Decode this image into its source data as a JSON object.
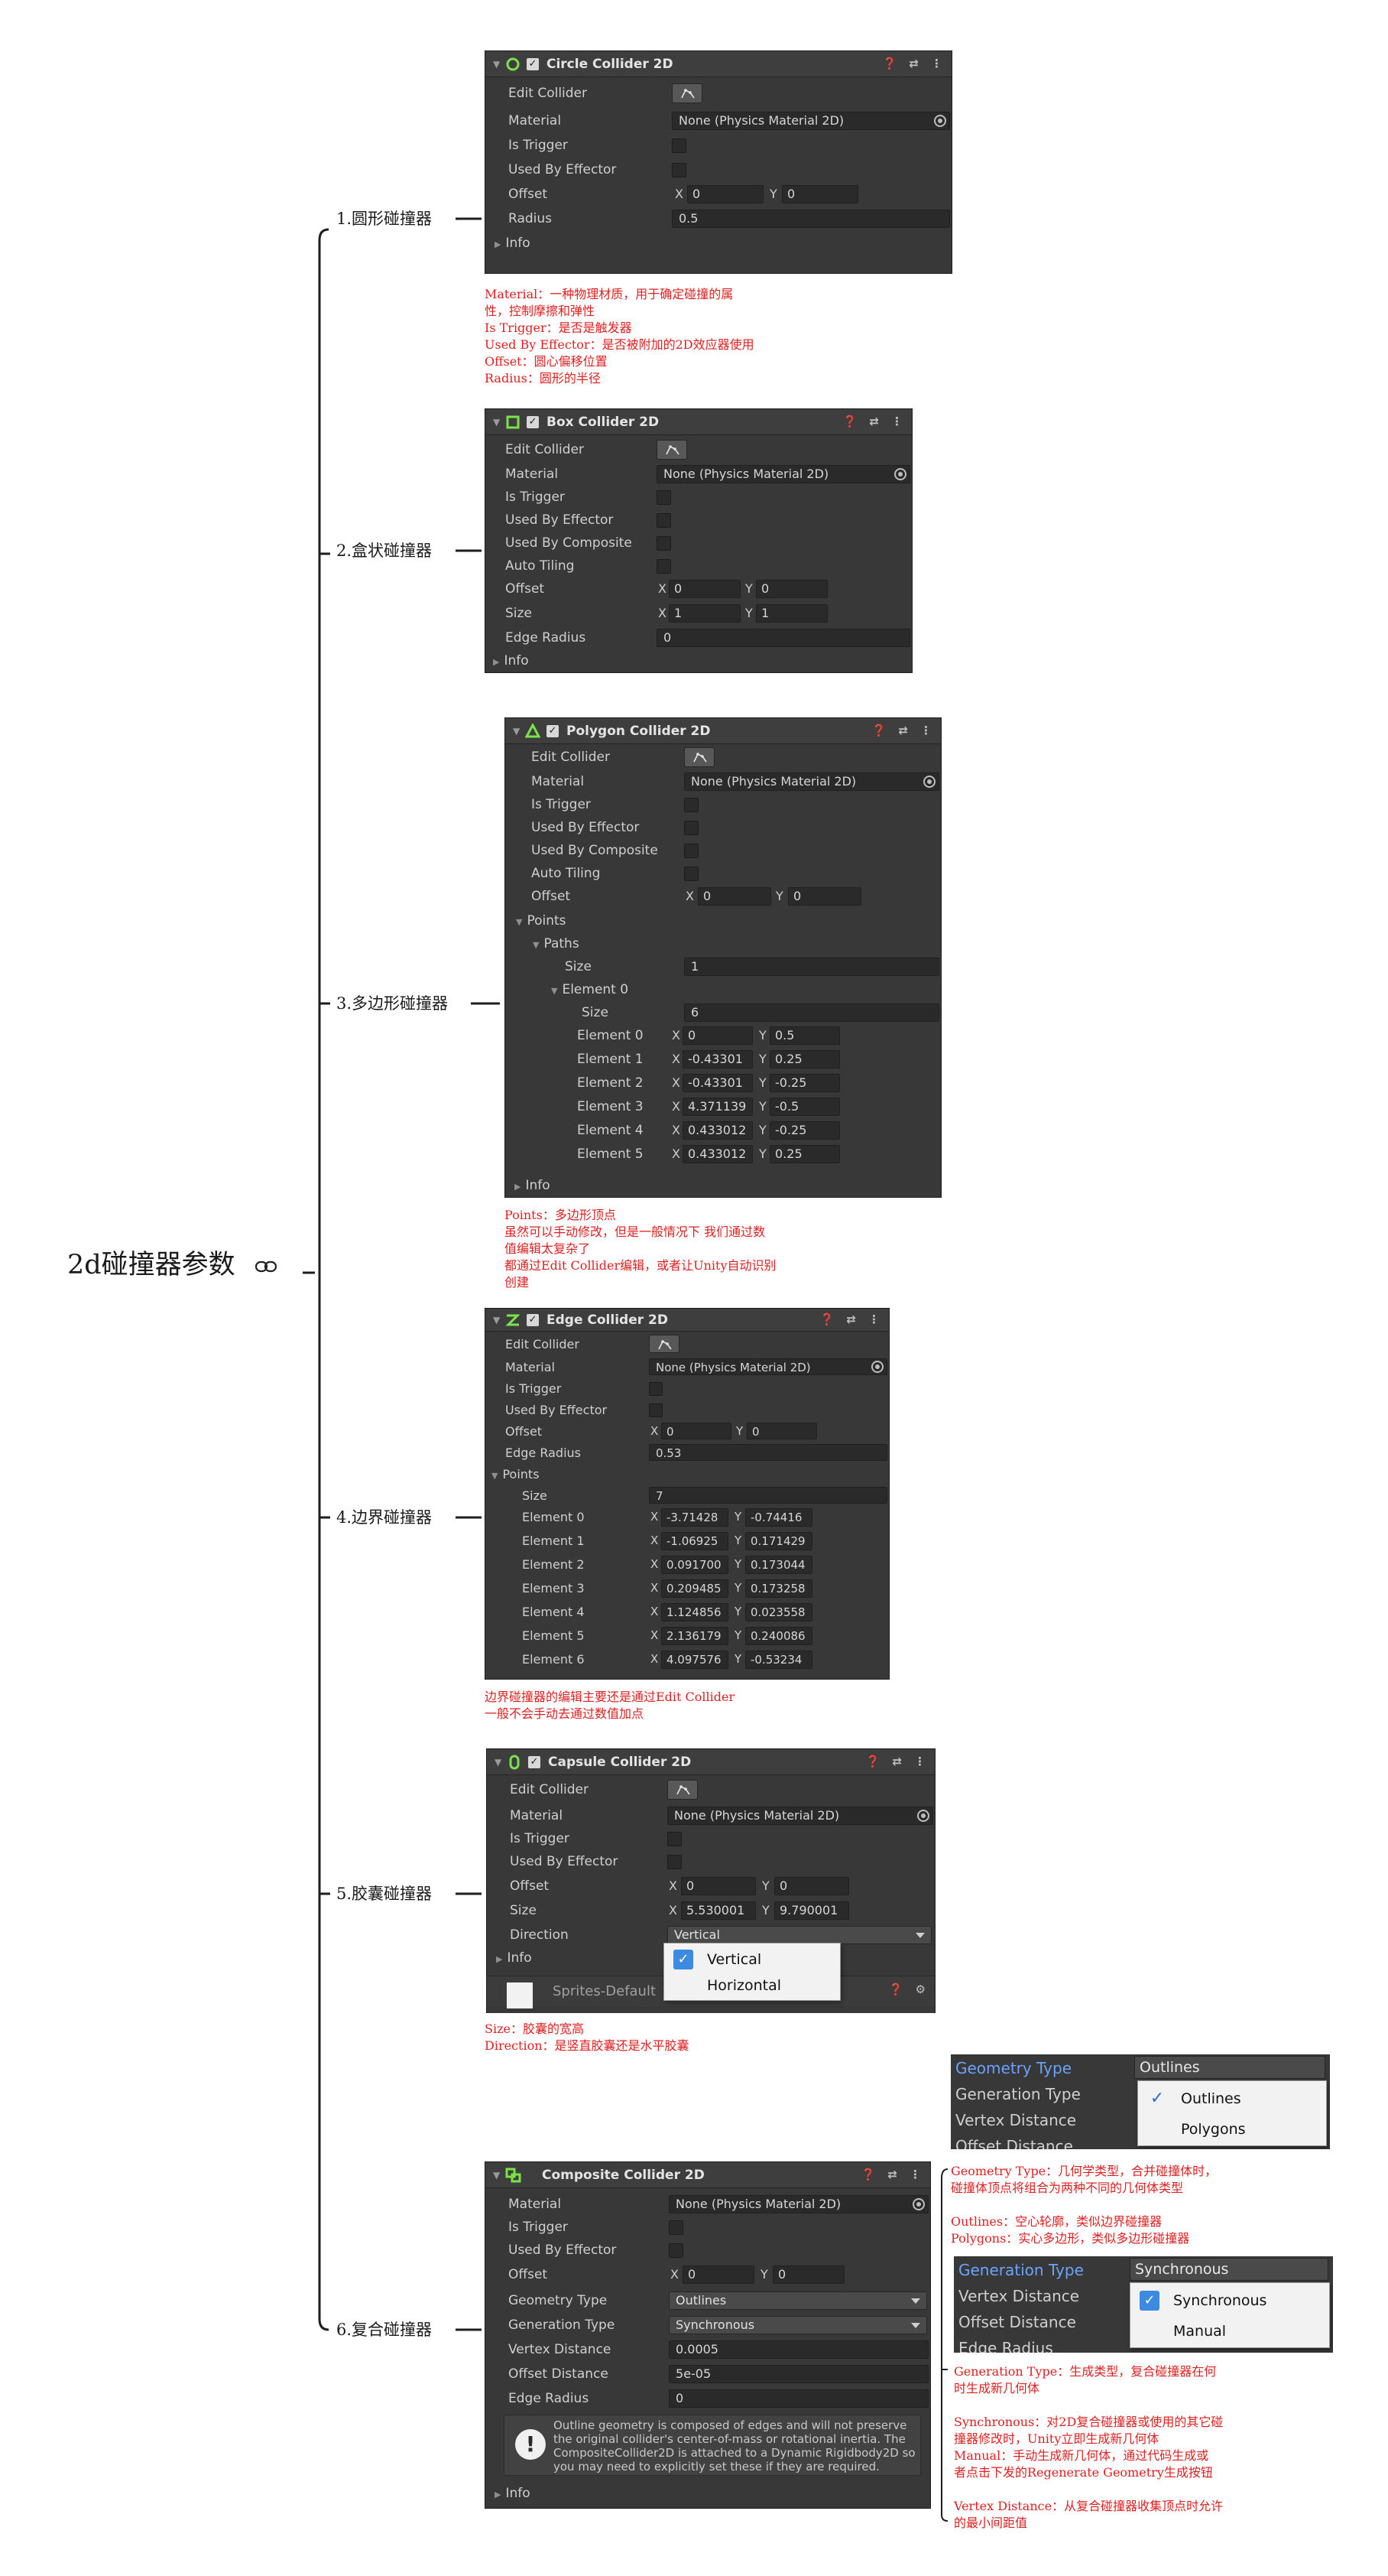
{
  "root": {
    "label": "2d碰撞器参数"
  },
  "branches": [
    "1.圆形碰撞器",
    "2.盒状碰撞器",
    "3.多边形碰撞器",
    "4.边界碰撞器",
    "5.胶囊碰撞器",
    "6.复合碰撞器"
  ],
  "common": {
    "edit_collider": "Edit Collider",
    "material": "Material",
    "material_value": "None (Physics Material 2D)",
    "is_trigger": "Is Trigger",
    "used_by_effector": "Used By Effector",
    "used_by_composite": "Used By Composite",
    "auto_tiling": "Auto Tiling",
    "offset": "Offset",
    "size": "Size",
    "radius": "Radius",
    "edge_radius": "Edge Radius",
    "points": "Points",
    "paths": "Paths",
    "info": "Info",
    "x": "X",
    "y": "Y"
  },
  "circle": {
    "title": "Circle Collider 2D",
    "offset_x": "0",
    "offset_y": "0",
    "radius": "0.5"
  },
  "circle_notes": [
    "Material：一种物理材质，用于确定碰撞的属",
    "性，控制摩擦和弹性",
    "Is Trigger：是否是触发器",
    "Used By Effector：是否被附加的2D效应器使用",
    "Offset：圆心偏移位置",
    "Radius：圆形的半径"
  ],
  "box": {
    "title": "Box Collider 2D",
    "offset_x": "0",
    "offset_y": "0",
    "size_x": "1",
    "size_y": "1",
    "edge_radius": "0"
  },
  "polygon": {
    "title": "Polygon Collider 2D",
    "offset_x": "0",
    "offset_y": "0",
    "paths_size": "1",
    "element0_label": "Element 0",
    "element_size": "6",
    "elements": [
      {
        "label": "Element 0",
        "x": "0",
        "y": "0.5"
      },
      {
        "label": "Element 1",
        "x": "-0.43301",
        "y": "0.25"
      },
      {
        "label": "Element 2",
        "x": "-0.43301",
        "y": "-0.25"
      },
      {
        "label": "Element 3",
        "x": "4.371139",
        "y": "-0.5"
      },
      {
        "label": "Element 4",
        "x": "0.433012",
        "y": "-0.25"
      },
      {
        "label": "Element 5",
        "x": "0.433012",
        "y": "0.25"
      }
    ]
  },
  "polygon_notes": [
    "Points：多边形顶点",
    "虽然可以手动修改，但是一般情况下 我们通过数",
    "值编辑太复杂了",
    "都通过Edit Collider编辑，或者让Unity自动识别",
    "创建"
  ],
  "edge": {
    "title": "Edge Collider 2D",
    "offset_x": "0",
    "offset_y": "0",
    "edge_radius": "0.53",
    "points_size": "7",
    "elements": [
      {
        "label": "Element 0",
        "x": "-3.71428",
        "y": "-0.74416"
      },
      {
        "label": "Element 1",
        "x": "-1.06925",
        "y": "0.171429"
      },
      {
        "label": "Element 2",
        "x": "0.091700",
        "y": "0.173044"
      },
      {
        "label": "Element 3",
        "x": "0.209485",
        "y": "0.173258"
      },
      {
        "label": "Element 4",
        "x": "1.124856",
        "y": "0.023558"
      },
      {
        "label": "Element 5",
        "x": "2.136179",
        "y": "0.240086"
      },
      {
        "label": "Element 6",
        "x": "4.097576",
        "y": "-0.53234"
      }
    ]
  },
  "edge_notes": [
    "边界碰撞器的编辑主要还是通过Edit Collider",
    "一般不会手动去通过数值加点"
  ],
  "capsule": {
    "title": "Capsule Collider 2D",
    "offset_x": "0",
    "offset_y": "0",
    "size_x": "5.530001",
    "size_y": "9.790001",
    "direction_label": "Direction",
    "direction_value": "Vertical",
    "options": [
      "Vertical",
      "Horizontal"
    ],
    "behind_text": "Sprites-Default"
  },
  "capsule_notes": [
    "Size：胶囊的宽高",
    "Direction：是竖直胶囊还是水平胶囊"
  ],
  "composite": {
    "title": "Composite Collider 2D",
    "offset_x": "0",
    "offset_y": "0",
    "geometry_type_label": "Geometry Type",
    "geometry_type_value": "Outlines",
    "generation_type_label": "Generation Type",
    "generation_type_value": "Synchronous",
    "vertex_distance_label": "Vertex Distance",
    "vertex_distance_value": "0.0005",
    "offset_distance_label": "Offset Distance",
    "offset_distance_value": "5e-05",
    "edge_radius_value": "0",
    "help_text": "Outline geometry is composed of edges and will not preserve the original collider's center-of-mass or rotational inertia.  The CompositeCollider2D is attached to a Dynamic Rigidbody2D so you may need to explicitly set these if they are required."
  },
  "geometry_popup": {
    "rows": [
      "Geometry Type",
      "Generation Type",
      "Vertex Distance",
      "Offset Distance"
    ],
    "value": "Outlines",
    "options": [
      "Outlines",
      "Polygons"
    ]
  },
  "generation_popup": {
    "rows": [
      "Generation Type",
      "Vertex Distance",
      "Offset Distance",
      "Edge Radius"
    ],
    "value": "Synchronous",
    "options": [
      "Synchronous",
      "Manual"
    ]
  },
  "composite_notes_a": [
    "Geometry Type：几何学类型，合并碰撞体时，",
    "碰撞体顶点将组合为两种不同的几何体类型",
    "",
    "Outlines：空心轮廓，类似边界碰撞器",
    "Polygons：实心多边形，类似多边形碰撞器"
  ],
  "composite_notes_b": [
    "Generation Type：生成类型，复合碰撞器在何",
    "时生成新几何体",
    "",
    "Synchronous：对2D复合碰撞器或使用的其它碰",
    "撞器修改时，Unity立即生成新几何体",
    "Manual：手动生成新几何体，通过代码生成或",
    "者点击下发的Regenerate Geometry生成按钮",
    "",
    "Vertex Distance：从复合碰撞器收集顶点时允许",
    "的最小间距值"
  ]
}
